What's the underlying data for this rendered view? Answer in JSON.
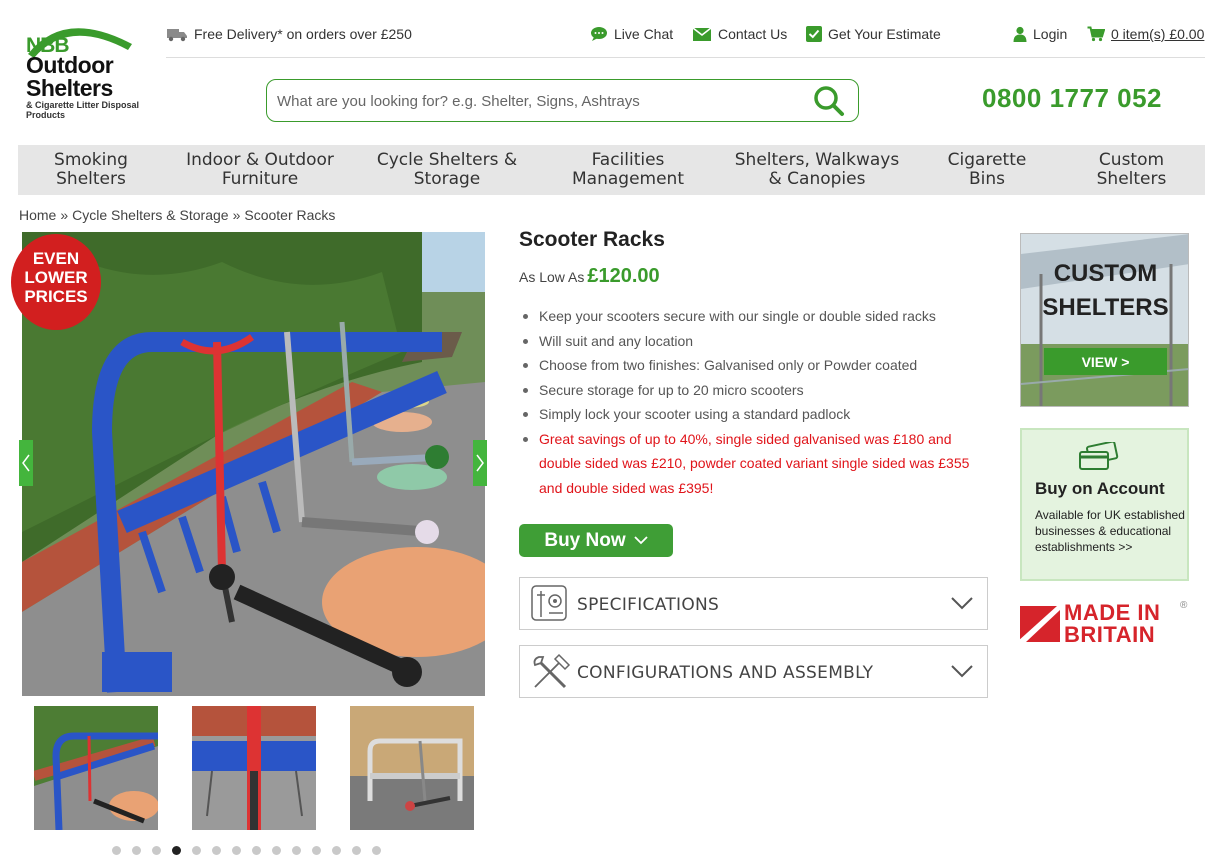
{
  "brand": {
    "logo_line1": "NBB",
    "logo_line2": "Outdoor",
    "logo_line3": "Shelters",
    "logo_line4": "& Cigarette Litter Disposal Products",
    "green": "#3a9b2c"
  },
  "topbar": {
    "delivery": "Free Delivery* on orders over £250",
    "live_chat": "Live Chat",
    "contact": "Contact Us",
    "estimate": "Get Your Estimate",
    "login": "Login",
    "cart": "0 item(s) £0.00"
  },
  "search": {
    "placeholder": "What are you looking for? e.g. Shelter, Signs, Ashtrays"
  },
  "phone": "0800 1777 052",
  "nav": [
    {
      "label": "Smoking\nShelters"
    },
    {
      "label": "Indoor & Outdoor\nFurniture"
    },
    {
      "label": "Cycle Shelters &\nStorage"
    },
    {
      "label": "Facilities\nManagement"
    },
    {
      "label": "Shelters, Walkways\n& Canopies"
    },
    {
      "label": "Cigarette\nBins"
    },
    {
      "label": "Custom\nShelters"
    }
  ],
  "breadcrumb": {
    "home": "Home",
    "sep": "»",
    "category": "Cycle Shelters & Storage",
    "current": "Scooter Racks"
  },
  "gallery": {
    "badge": "EVEN\nLOWER\nPRICES",
    "dots_total": 14,
    "active_dot": 3
  },
  "product": {
    "title": "Scooter Racks",
    "price_prefix": "As Low As",
    "price": "£120.00",
    "bullets": [
      "Keep your scooters secure with our single or double sided racks",
      "Will suit and any location",
      "Choose from two finishes: Galvanised only or Powder coated",
      "Secure storage for up to 20 micro scooters",
      "Simply lock your scooter using a standard padlock"
    ],
    "highlight": "Great savings of up to 40%, single sided galvanised was £180 and double sided was £210, powder coated variant single sided was £355 and double sided was £395!",
    "buy_label": "Buy Now"
  },
  "accordions": {
    "specs": "SPECIFICATIONS",
    "config": "CONFIGURATIONS AND ASSEMBLY"
  },
  "side": {
    "custom_line1": "CUSTOM",
    "custom_line2": "SHELTERS",
    "custom_view": "VIEW >",
    "account_title": "Buy on Account",
    "account_desc": "Available for UK established businesses & educational establishments >>",
    "made_line1": "MADE IN",
    "made_line2": "BRITAIN",
    "made_reg": "®"
  }
}
